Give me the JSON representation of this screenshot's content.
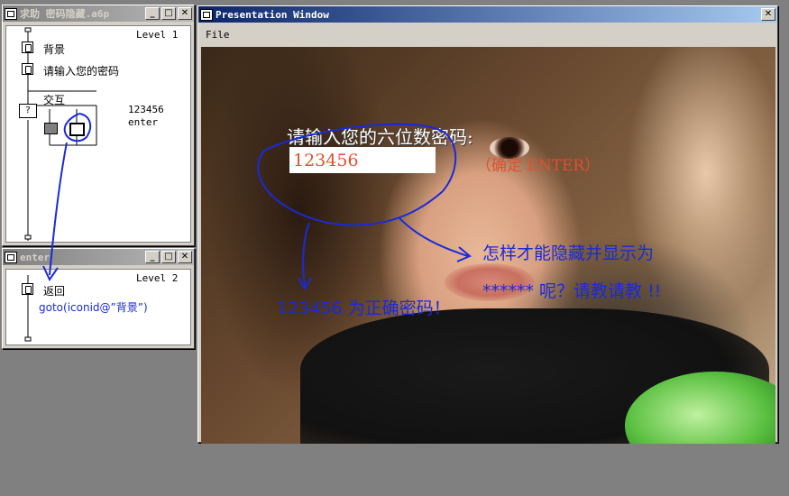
{
  "level1_window": {
    "title": "求助 密码隐藏.a6p",
    "level": "Level 1",
    "icon_labels": [
      "背景",
      "请输入您的密码",
      "交互"
    ],
    "response": [
      "123456",
      "enter"
    ]
  },
  "level2_window": {
    "title": "enter",
    "level": "Level 2",
    "icon_label": "返回",
    "code": "goto(iconid@”背景”)"
  },
  "presentation_window": {
    "title": "Presentation Window",
    "menu_file": "File",
    "prompt": "请输入您的六位数密码:",
    "password_value": "123456",
    "hint": "（确定 ENTER）"
  },
  "annotations": {
    "correct": "123456 为正确密码！",
    "question_line1": "怎样才能隐藏并显示为",
    "question_line2": "****** 呢？请教请教 !!"
  },
  "colors": {
    "annotation": "#1a2ad8",
    "hint": "#e05030",
    "title_active": "#0a246a"
  }
}
